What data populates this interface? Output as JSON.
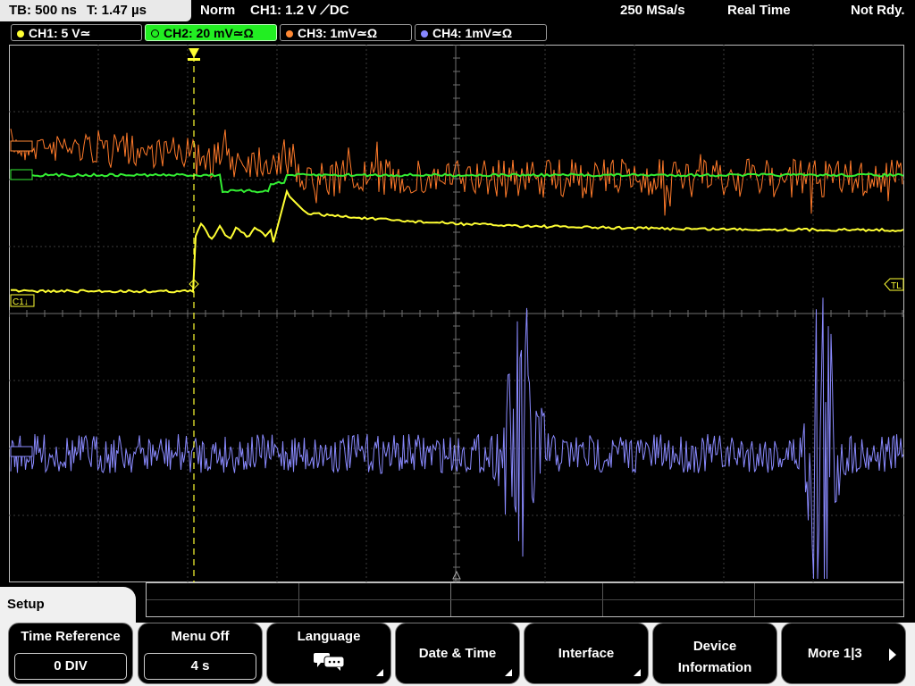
{
  "status_bar": {
    "timebase": "TB: 500 ns",
    "trigger_time": "T: 1.47 µs",
    "trigger_mode": "Norm",
    "trigger_info": "CH1: 1.2 V ⟋DC",
    "sample_rate": "250 MSa/s",
    "acq_mode": "Real Time",
    "state": "Not Rdy."
  },
  "channels": [
    {
      "label": "CH1: 5 V≃",
      "color": "#ffff33"
    },
    {
      "label": "CH2: 20 mV≃Ω",
      "color": "#33ff33"
    },
    {
      "label": "CH3: 1mV≃Ω",
      "color": "#ff8833"
    },
    {
      "label": "CH4: 1mV≃Ω",
      "color": "#8888ff"
    }
  ],
  "markers": {
    "ch1": "C1↓",
    "trigger_level": "TL"
  },
  "menu": {
    "title": "Setup",
    "softkeys": [
      {
        "label": "Time Reference",
        "value": "0 DIV"
      },
      {
        "label": "Menu Off",
        "value": "4 s"
      },
      {
        "label": "Language",
        "icon": "speech-bubbles-icon"
      },
      {
        "label": "Date & Time"
      },
      {
        "label": "Interface"
      },
      {
        "label": "Device Information"
      },
      {
        "label": "More 1|3"
      }
    ]
  },
  "colors": {
    "ch1": "#ffff33",
    "ch2": "#33ff33",
    "ch3": "#ff8833",
    "ch4": "#8888ff",
    "grid": "#6a6a6a",
    "trigger_line": "#ffff33"
  }
}
